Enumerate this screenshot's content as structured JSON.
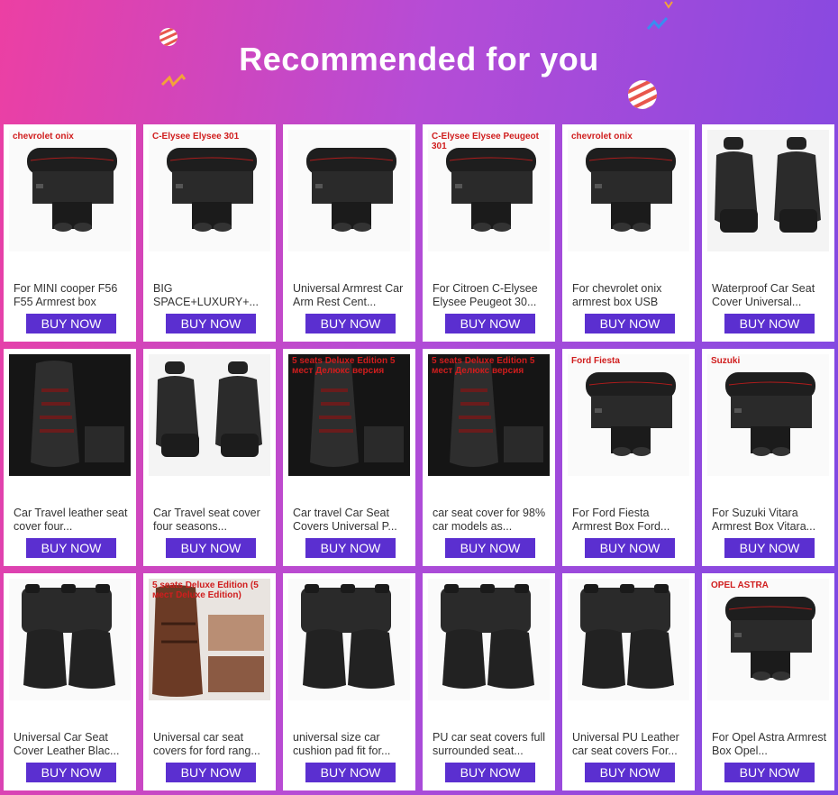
{
  "header": {
    "title": "Recommended for you"
  },
  "colors": {
    "accent": "#5b2fd0",
    "banner_start": "#ec3fa3",
    "banner_end": "#7b48e3"
  },
  "products": [
    {
      "title": "For MINI cooper F56 F55 Armrest box",
      "button": "BUY NOW",
      "image": "armrest-icon",
      "overlay": "chevrolet onix"
    },
    {
      "title": "BIG SPACE+LUXURY+...",
      "button": "BUY NOW",
      "image": "armrest-icon",
      "overlay": "C-Elysee Elysee 301"
    },
    {
      "title": "Universal Armrest Car Arm Rest Cent...",
      "button": "BUY NOW",
      "image": "armrest-icon",
      "overlay": ""
    },
    {
      "title": "For Citroen C-Elysee Elysee Peugeot 30...",
      "button": "BUY NOW",
      "image": "armrest-icon",
      "overlay": "C-Elysee Elysee Peugeot 301"
    },
    {
      "title": "For chevrolet onix armrest box USB",
      "button": "BUY NOW",
      "image": "armrest-icon",
      "overlay": "chevrolet onix"
    },
    {
      "title": "Waterproof Car Seat Cover Universal...",
      "button": "BUY NOW",
      "image": "seat-icon",
      "overlay": ""
    },
    {
      "title": "Car Travel leather seat cover four...",
      "button": "BUY NOW",
      "image": "seat-interior-icon",
      "overlay": ""
    },
    {
      "title": "Car Travel seat cover four seasons...",
      "button": "BUY NOW",
      "image": "seat-icon",
      "overlay": ""
    },
    {
      "title": "Car travel Car Seat Covers Universal P...",
      "button": "BUY NOW",
      "image": "seat-interior-icon",
      "overlay": "5 seats Deluxe Edition 5 мест Делюкс версия"
    },
    {
      "title": "car seat cover for 98% car models as...",
      "button": "BUY NOW",
      "image": "seat-interior-icon",
      "overlay": "5 seats Deluxe Edition 5 мест Делюкс версия"
    },
    {
      "title": "For Ford Fiesta Armrest Box Ford...",
      "button": "BUY NOW",
      "image": "armrest-icon",
      "overlay": "Ford Fiesta"
    },
    {
      "title": "For Suzuki Vitara Armrest Box Vitara...",
      "button": "BUY NOW",
      "image": "armrest-icon",
      "overlay": "Suzuki"
    },
    {
      "title": "Universal Car Seat Cover Leather Blac...",
      "button": "BUY NOW",
      "image": "seat-set-icon",
      "overlay": ""
    },
    {
      "title": "Universal car seat covers for ford rang...",
      "button": "BUY NOW",
      "image": "seat-brown-icon",
      "overlay": "5 seats Deluxe Edition (5 мест Deluxe Edition)"
    },
    {
      "title": "universal size car cushion pad fit for...",
      "button": "BUY NOW",
      "image": "seat-set-icon",
      "overlay": ""
    },
    {
      "title": "PU car seat covers full surrounded seat...",
      "button": "BUY NOW",
      "image": "seat-set-icon",
      "overlay": ""
    },
    {
      "title": "Universal PU Leather car seat covers For...",
      "button": "BUY NOW",
      "image": "seat-set-icon",
      "overlay": ""
    },
    {
      "title": "For Opel Astra Armrest Box Opel...",
      "button": "BUY NOW",
      "image": "armrest-icon",
      "overlay": "OPEL ASTRA"
    }
  ]
}
